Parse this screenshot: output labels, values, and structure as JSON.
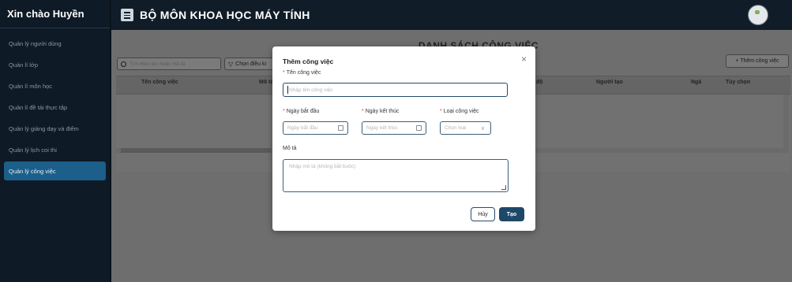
{
  "sidebar": {
    "greeting": "Xin chào Huyền",
    "items": [
      {
        "label": "Quản lý người dùng"
      },
      {
        "label": "Quản lí lớp"
      },
      {
        "label": "Quản lí môn học"
      },
      {
        "label": "Quản lí đề tài thực tập"
      },
      {
        "label": "Quản lý giảng dạy và điểm"
      },
      {
        "label": "Quản lý lịch coi thi"
      },
      {
        "label": "Quản lý công việc"
      }
    ],
    "active_index": 6
  },
  "header": {
    "title": "BỘ MÔN KHOA HỌC MÁY TÍNH",
    "menu_icon": "menu-icon",
    "avatar_icon": "avatar"
  },
  "main": {
    "list_title": "DANH SÁCH CÔNG VIỆC",
    "search_placeholder": "Tìm theo tên hoặc mô tả",
    "filter_label": "Chọn điều ki",
    "add_button": "+ Thêm công việc",
    "columns": [
      "Tên công việc",
      "Mô tả",
      "độ",
      "Người tạo",
      "Ngà",
      "Tùy chọn"
    ]
  },
  "modal": {
    "title": "Thêm công việc",
    "close_symbol": "×",
    "name_label": "Tên công việc",
    "name_placeholder": "Nhập tên công việc",
    "start_label": "Ngày bắt đầu",
    "start_placeholder": "Ngày bắt đầu",
    "end_label": "Ngày kết thúc",
    "end_placeholder": "Ngày kết thúc",
    "type_label": "Loại công việc",
    "type_placeholder": "Chọn loại",
    "desc_label": "Mô tả",
    "desc_placeholder": "Nhập mô tả (không bắt buộc)",
    "cancel": "Hủy",
    "create": "Tạo"
  },
  "colors": {
    "sidebar_bg": "#0e1a25",
    "active_item": "#1c5f8b",
    "primary_button": "#1d4868",
    "required_mark": "#e0393e"
  }
}
